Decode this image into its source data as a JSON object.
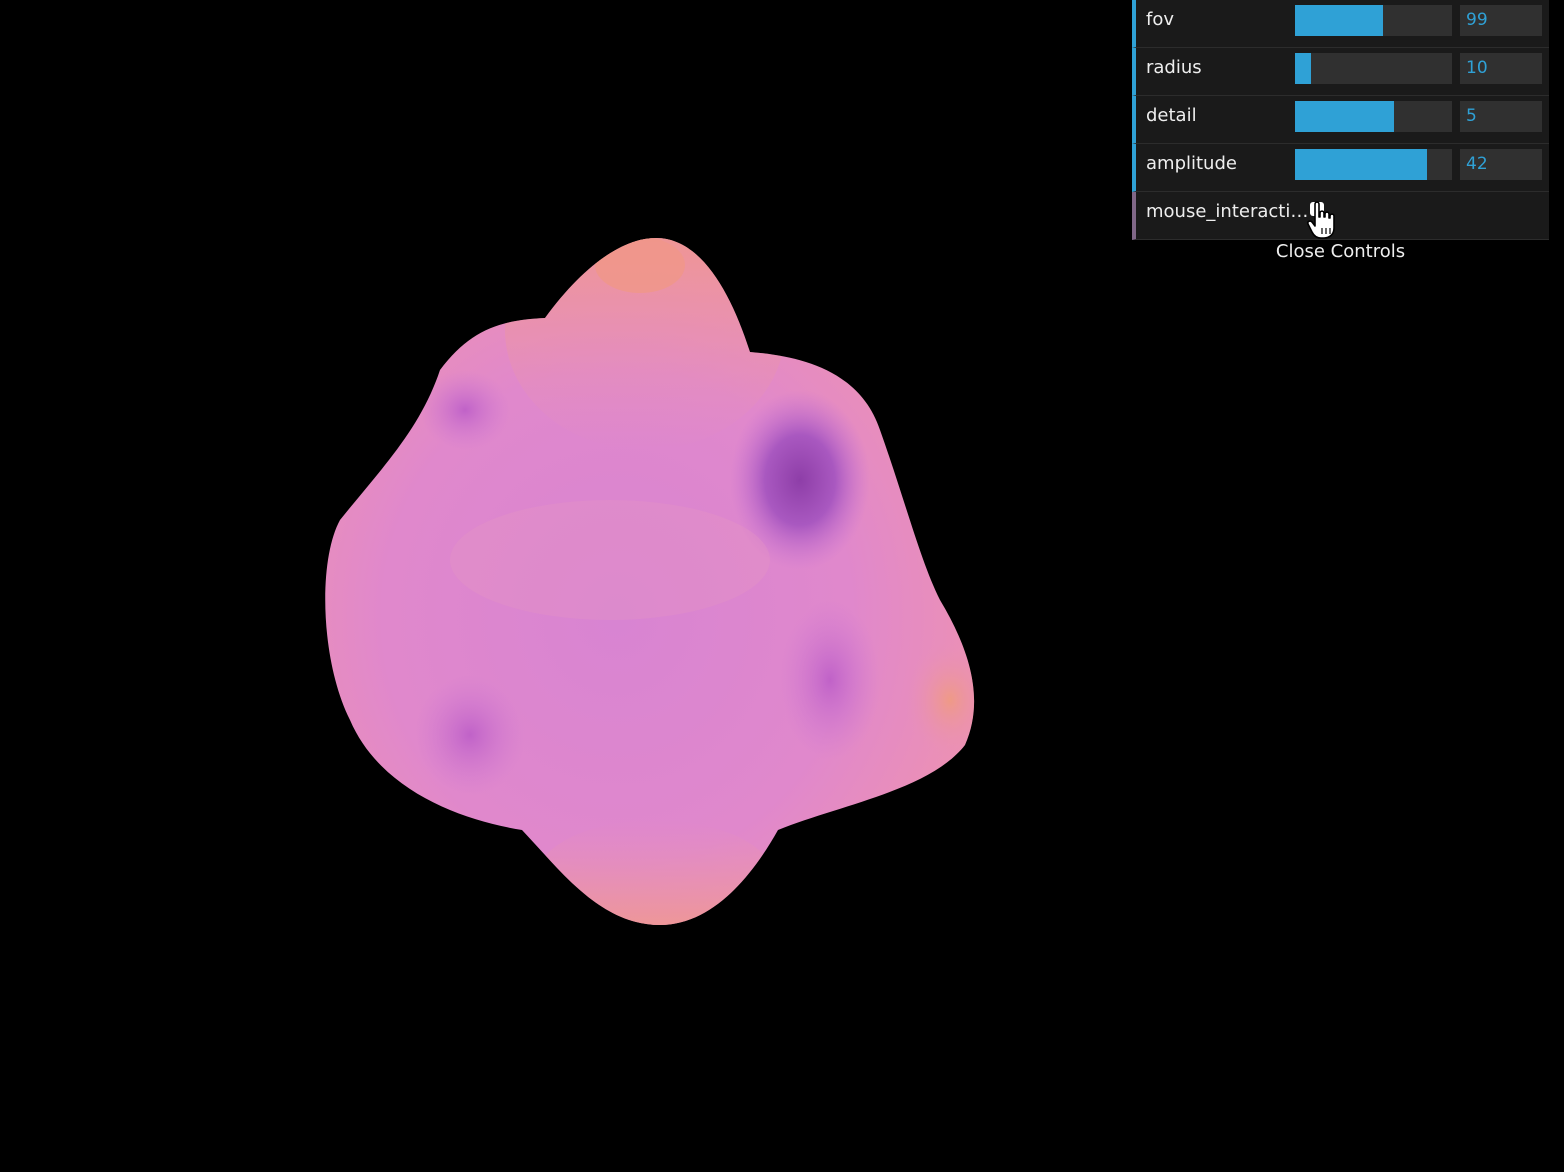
{
  "controls": {
    "fov": {
      "label": "fov",
      "value": "99",
      "fraction": 0.56
    },
    "radius": {
      "label": "radius",
      "value": "10",
      "fraction": 0.1
    },
    "detail": {
      "label": "detail",
      "value": "5",
      "fraction": 0.63
    },
    "amplitude": {
      "label": "amplitude",
      "value": "42",
      "fraction": 0.84
    },
    "mouse_interaction": {
      "label": "mouse_interacti…",
      "checked": false
    },
    "close_label": "Close Controls"
  },
  "colors": {
    "background": "#000000",
    "panel": "#1a1a1a",
    "accent": "#2fa1d6",
    "blob_pink": "#e08ad0",
    "blob_peach": "#f0958a",
    "blob_purple": "#9a4fb8"
  },
  "icons": {
    "cursor": "hand-pointer-icon"
  }
}
